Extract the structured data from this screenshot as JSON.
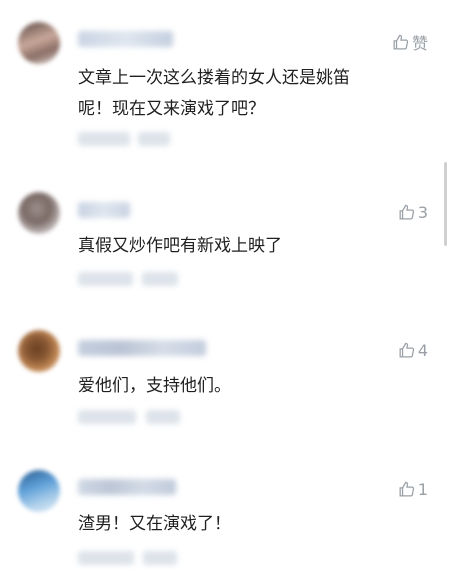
{
  "comments": [
    {
      "text_line1": "文章上一次这么搂着的女人还是姚笛",
      "text_line2": "呢！现在又来演戏了吧？",
      "like_label": "赞"
    },
    {
      "text": "真假又炒作吧有新戏上映了",
      "like_count": "3"
    },
    {
      "text": "爱他们，支持他们。",
      "like_count": "4"
    },
    {
      "text": "渣男！又在演戏了！",
      "like_count": "1"
    }
  ],
  "colors": {
    "like_gray": "#9aa0a6",
    "text": "#1f1f1f"
  }
}
